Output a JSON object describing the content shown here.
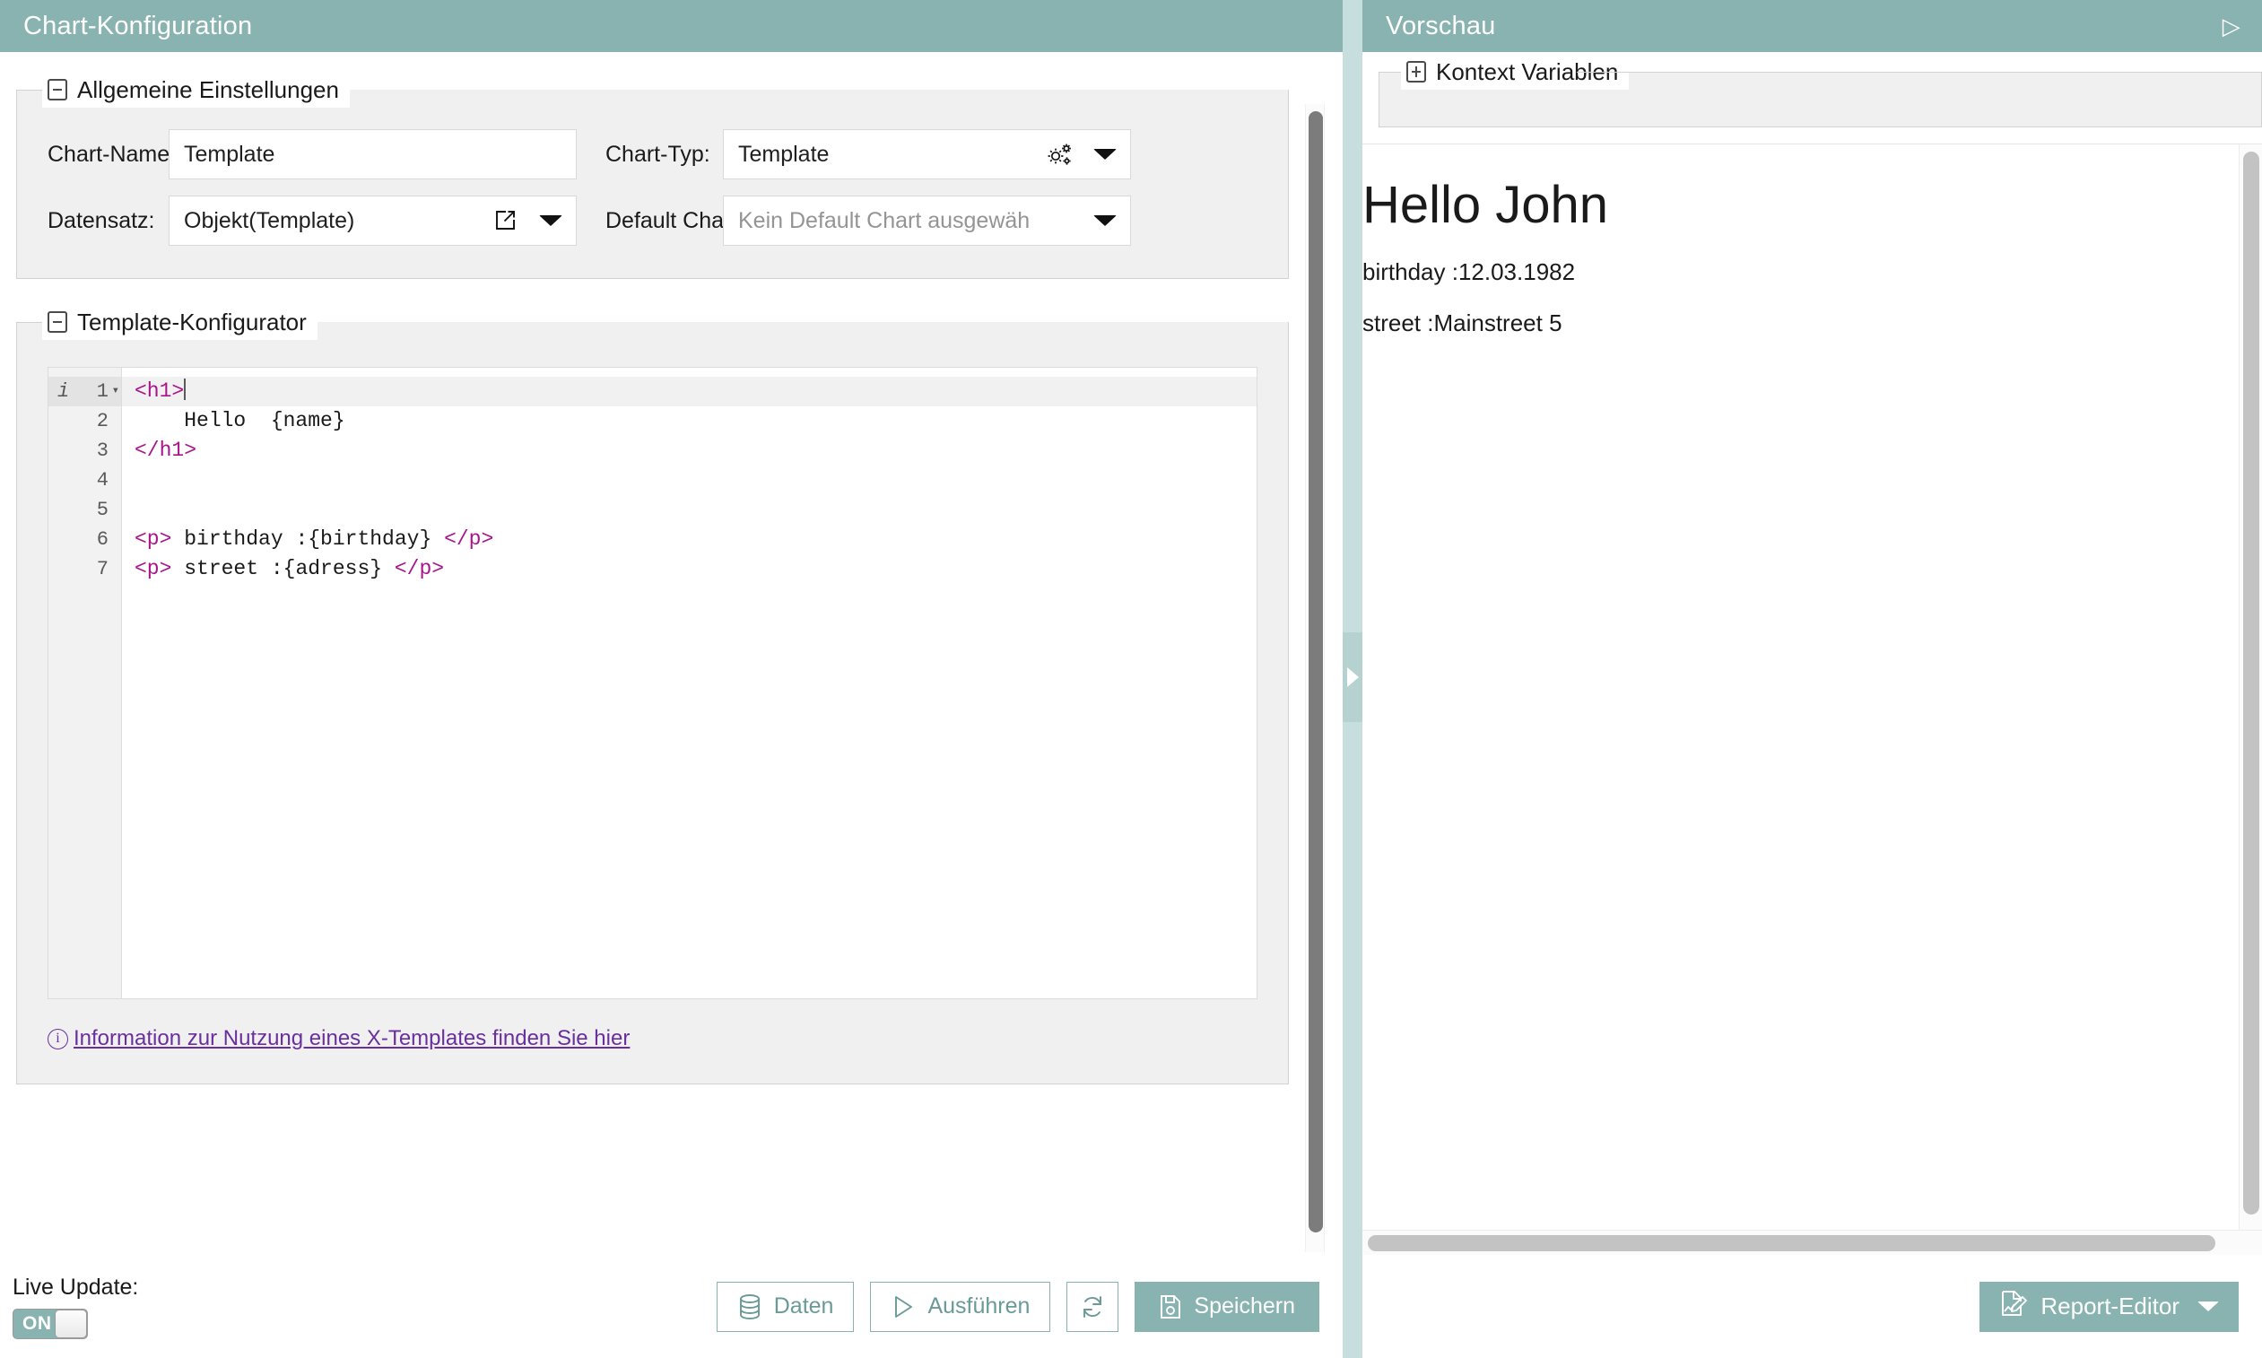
{
  "left": {
    "header": {
      "title": "Chart-Konfiguration"
    },
    "general_settings": {
      "legend": "Allgemeine Einstellungen",
      "fields": {
        "chart_name_label": "Chart-Name:",
        "chart_name_value": "Template",
        "chart_type_label": "Chart-Typ:",
        "chart_type_value": "Template",
        "dataset_label": "Datensatz:",
        "dataset_value": "Objekt(Template)",
        "default_chart_label": "Default Chart:",
        "default_chart_placeholder": "Kein Default Chart ausgewäh"
      }
    },
    "template_configurator": {
      "legend": "Template-Konfigurator",
      "editor": {
        "lines": [
          {
            "num": "1",
            "active": true,
            "gutter_info": "i",
            "fold": "▾",
            "parts": [
              {
                "t": "tag",
                "s": "<h1>"
              }
            ],
            "caret": true
          },
          {
            "num": "2",
            "active": false,
            "gutter_info": "",
            "fold": "",
            "parts": [
              {
                "t": "txt",
                "s": "    Hello  {name}"
              }
            ],
            "caret": false
          },
          {
            "num": "3",
            "active": false,
            "gutter_info": "",
            "fold": "",
            "parts": [
              {
                "t": "tag",
                "s": "</h1>"
              }
            ],
            "caret": false
          },
          {
            "num": "4",
            "active": false,
            "gutter_info": "",
            "fold": "",
            "parts": [
              {
                "t": "txt",
                "s": ""
              }
            ],
            "caret": false
          },
          {
            "num": "5",
            "active": false,
            "gutter_info": "",
            "fold": "",
            "parts": [
              {
                "t": "txt",
                "s": ""
              }
            ],
            "caret": false
          },
          {
            "num": "6",
            "active": false,
            "gutter_info": "",
            "fold": "",
            "parts": [
              {
                "t": "tag",
                "s": "<p>"
              },
              {
                "t": "txt",
                "s": " birthday :{birthday} "
              },
              {
                "t": "tag",
                "s": "</p>"
              }
            ],
            "caret": false
          },
          {
            "num": "7",
            "active": false,
            "gutter_info": "",
            "fold": "",
            "parts": [
              {
                "t": "tag",
                "s": "<p>"
              },
              {
                "t": "txt",
                "s": " street :{adress} "
              },
              {
                "t": "tag",
                "s": "</p>"
              }
            ],
            "caret": false
          }
        ]
      },
      "info_link": "Information zur Nutzung eines X-Templates finden Sie hier"
    },
    "toolbar": {
      "live_update_label": "Live Update:",
      "live_update_state": "ON",
      "daten_label": "Daten",
      "ausfuehren_label": "Ausführen",
      "refresh_label": "",
      "speichern_label": "Speichern"
    }
  },
  "right": {
    "header": {
      "title": "Vorschau",
      "collapse_glyph": "▷"
    },
    "context_variables": {
      "legend": "Kontext Variablen"
    },
    "preview": {
      "heading": "Hello John",
      "line_birthday": "birthday :12.03.1982",
      "line_street": "street :Mainstreet 5"
    },
    "toolbar": {
      "report_editor_label": "Report-Editor"
    }
  },
  "colors": {
    "accent": "#89b3b0",
    "splitter": "#c6dedd",
    "group_bg": "#f0f0f0",
    "link": "#6a2f9e",
    "code_tag": "#a9148a"
  }
}
